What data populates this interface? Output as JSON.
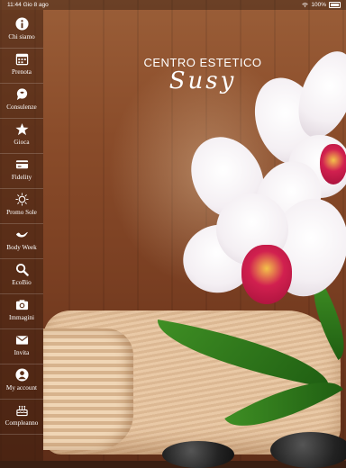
{
  "status_bar": {
    "time": "11:44",
    "date": "Gio 8 ago",
    "battery": "100%"
  },
  "logo": {
    "line1": "CENTRO ESTETICO",
    "line2": "Susy"
  },
  "sidebar": {
    "items": [
      {
        "label": "Chi siamo",
        "icon": "info-icon"
      },
      {
        "label": "Prenota",
        "icon": "calendar-icon"
      },
      {
        "label": "Consulenze",
        "icon": "chat-icon"
      },
      {
        "label": "Gioca",
        "icon": "star-icon"
      },
      {
        "label": "Fidelity",
        "icon": "card-icon"
      },
      {
        "label": "Promo Sole",
        "icon": "sun-icon"
      },
      {
        "label": "Body Week",
        "icon": "bird-icon"
      },
      {
        "label": "EcoBio",
        "icon": "search-icon"
      },
      {
        "label": "Immagini",
        "icon": "camera-icon"
      },
      {
        "label": "Invita",
        "icon": "mail-icon"
      },
      {
        "label": "My account",
        "icon": "user-icon"
      },
      {
        "label": "Compleanno",
        "icon": "cake-icon"
      }
    ]
  }
}
